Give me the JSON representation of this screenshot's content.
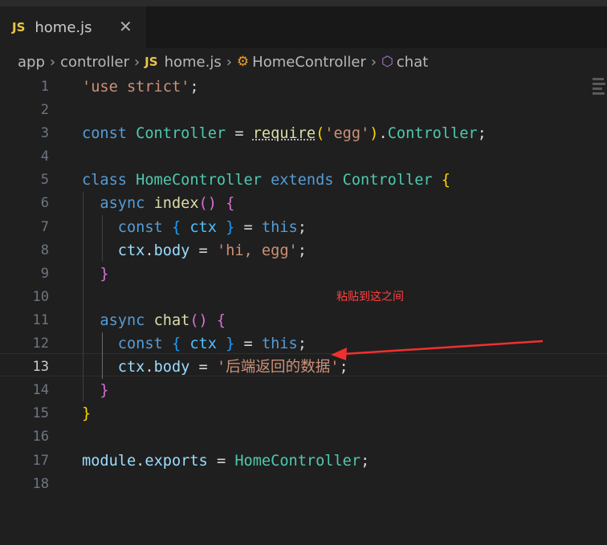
{
  "tab": {
    "icon": "JS",
    "filename": "home.js",
    "close_icon": "close-icon"
  },
  "breadcrumb": {
    "items": [
      "app",
      "controller",
      "home.js",
      "HomeController",
      "chat"
    ],
    "js_icon": "JS",
    "separator": "chevron-right-icon"
  },
  "annotation": "粘贴到这之间",
  "editor": {
    "active_line": 13,
    "line_numbers": [
      "1",
      "2",
      "3",
      "4",
      "5",
      "6",
      "7",
      "8",
      "9",
      "10",
      "11",
      "12",
      "13",
      "14",
      "15",
      "16",
      "17",
      "18"
    ],
    "lines": [
      [
        {
          "t": "'use strict'",
          "c": "str"
        },
        {
          "t": ";",
          "c": "punc"
        }
      ],
      [],
      [
        {
          "t": "const ",
          "c": "kw"
        },
        {
          "t": "Controller",
          "c": "cls"
        },
        {
          "t": " = ",
          "c": "punc"
        },
        {
          "t": "require",
          "c": "fn underline"
        },
        {
          "t": "(",
          "c": "br1"
        },
        {
          "t": "'egg'",
          "c": "str"
        },
        {
          "t": ")",
          "c": "br1"
        },
        {
          "t": ".",
          "c": "punc"
        },
        {
          "t": "Controller",
          "c": "cls"
        },
        {
          "t": ";",
          "c": "punc"
        }
      ],
      [],
      [
        {
          "t": "class ",
          "c": "kw"
        },
        {
          "t": "HomeController",
          "c": "cls"
        },
        {
          "t": " extends ",
          "c": "kw"
        },
        {
          "t": "Controller",
          "c": "cls"
        },
        {
          "t": " {",
          "c": "br1"
        }
      ],
      [
        {
          "t": "  async ",
          "c": "kw"
        },
        {
          "t": "index",
          "c": "fn"
        },
        {
          "t": "()",
          "c": "br2"
        },
        {
          "t": " {",
          "c": "br2"
        }
      ],
      [
        {
          "t": "    const ",
          "c": "kw"
        },
        {
          "t": "{ ",
          "c": "br3"
        },
        {
          "t": "ctx",
          "c": "cst"
        },
        {
          "t": " }",
          "c": "br3"
        },
        {
          "t": " = ",
          "c": "punc"
        },
        {
          "t": "this",
          "c": "kw"
        },
        {
          "t": ";",
          "c": "punc"
        }
      ],
      [
        {
          "t": "    ctx",
          "c": "var"
        },
        {
          "t": ".",
          "c": "punc"
        },
        {
          "t": "body",
          "c": "var"
        },
        {
          "t": " = ",
          "c": "punc"
        },
        {
          "t": "'hi, egg'",
          "c": "str"
        },
        {
          "t": ";",
          "c": "punc"
        }
      ],
      [
        {
          "t": "  }",
          "c": "br2"
        }
      ],
      [],
      [
        {
          "t": "  async ",
          "c": "kw"
        },
        {
          "t": "chat",
          "c": "fn"
        },
        {
          "t": "()",
          "c": "br2"
        },
        {
          "t": " {",
          "c": "br2"
        }
      ],
      [
        {
          "t": "    const ",
          "c": "kw"
        },
        {
          "t": "{ ",
          "c": "br3"
        },
        {
          "t": "ctx",
          "c": "cst"
        },
        {
          "t": " }",
          "c": "br3"
        },
        {
          "t": " = ",
          "c": "punc"
        },
        {
          "t": "this",
          "c": "kw"
        },
        {
          "t": ";",
          "c": "punc"
        }
      ],
      [
        {
          "t": "    ctx",
          "c": "var"
        },
        {
          "t": ".",
          "c": "punc"
        },
        {
          "t": "body",
          "c": "var"
        },
        {
          "t": " = ",
          "c": "punc"
        },
        {
          "t": "'后端返回的数据'",
          "c": "str"
        },
        {
          "t": ";",
          "c": "punc"
        }
      ],
      [
        {
          "t": "  }",
          "c": "br2"
        }
      ],
      [
        {
          "t": "}",
          "c": "br1"
        }
      ],
      [],
      [
        {
          "t": "module",
          "c": "var"
        },
        {
          "t": ".",
          "c": "punc"
        },
        {
          "t": "exports",
          "c": "var"
        },
        {
          "t": " = ",
          "c": "punc"
        },
        {
          "t": "HomeController",
          "c": "cls"
        },
        {
          "t": ";",
          "c": "punc"
        }
      ],
      []
    ]
  },
  "colors": {
    "background": "#1f1f1f",
    "keyword": "#569cd6",
    "string": "#ce9178",
    "class": "#4ec9b0",
    "function": "#dcdcaa",
    "variable": "#9cdcfe",
    "annotation": "#ff4040"
  }
}
